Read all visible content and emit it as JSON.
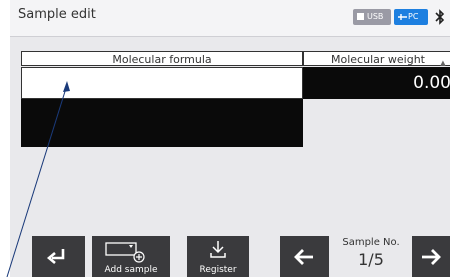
{
  "window": {
    "title": "Sample edit"
  },
  "status": {
    "usb_label": "USB",
    "pc_label": "PC",
    "bluetooth_icon": "bluetooth-icon"
  },
  "table": {
    "columns": [
      "Molecular formula",
      "Molecular weight"
    ],
    "rows": [
      {
        "formula": "",
        "weight": "0.00"
      }
    ]
  },
  "toolbar": {
    "back_icon": "return-arrow-icon",
    "add_sample_label": "Add sample",
    "register_label": "Register",
    "prev_icon": "arrow-left-icon",
    "sample_no_label": "Sample No.",
    "sample_no_value": "1/5",
    "next_icon": "arrow-right-icon"
  },
  "colors": {
    "pc_badge": "#1d7fe0",
    "usb_badge": "#9a9aa5",
    "button": "#3a3a3d",
    "cell_dark": "#0a0a0a",
    "background": "#e9e9ec"
  }
}
